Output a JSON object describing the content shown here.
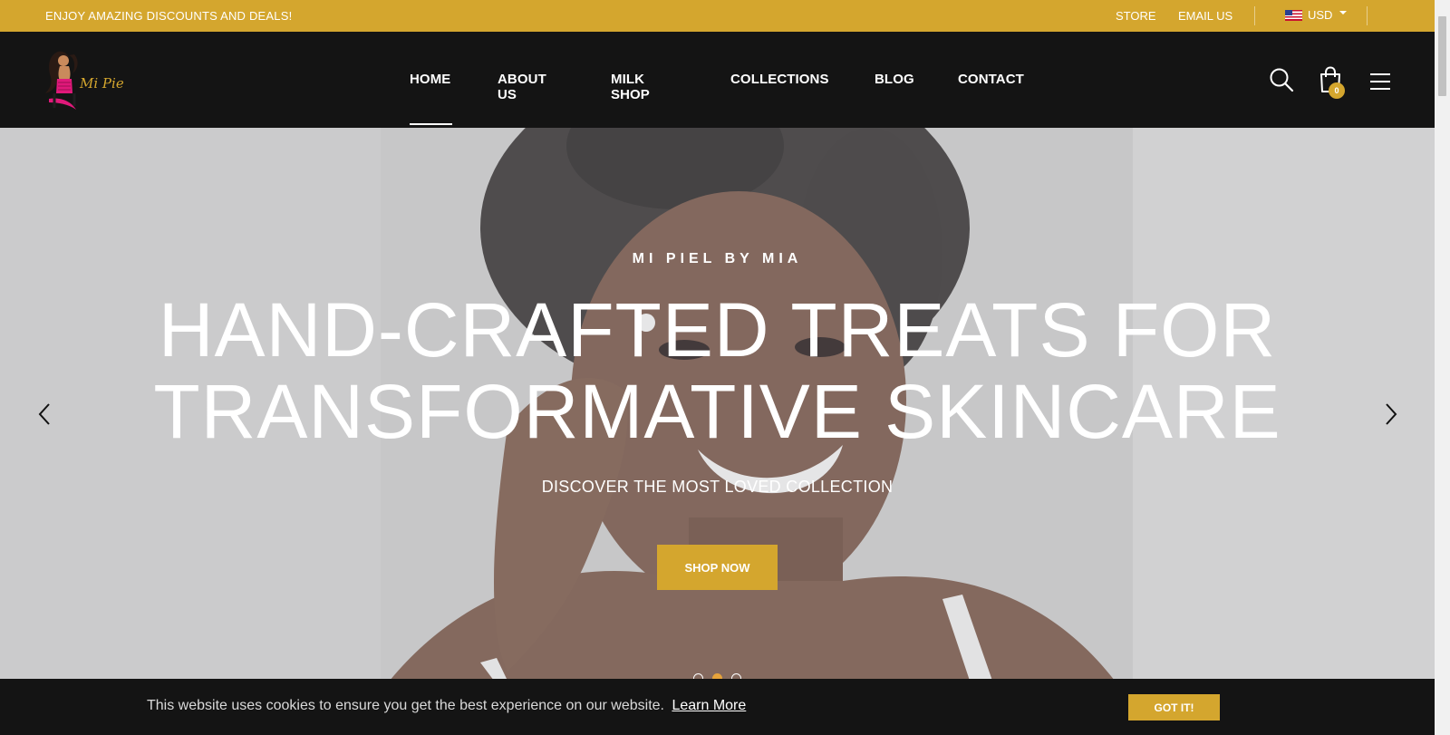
{
  "topbar": {
    "promo": "ENJOY AMAZING DISCOUNTS AND DEALS!",
    "links": [
      "STORE",
      "EMAIL US"
    ],
    "currency": "USD",
    "background": "#d4a62e"
  },
  "header": {
    "logo_text": "Mi Piel",
    "nav": [
      "HOME",
      "ABOUT US",
      "MILK SHOP",
      "COLLECTIONS",
      "BLOG",
      "CONTACT"
    ],
    "active_nav": "HOME",
    "cart_count": "0",
    "icons": [
      "search-icon",
      "cart-icon",
      "menu-icon"
    ],
    "background": "#141414"
  },
  "hero": {
    "eyebrow": "MI PIEL BY MIA",
    "title_line1": "HAND-CRAFTED TREATS FOR",
    "title_line2": "TRANSFORMATIVE SKINCARE",
    "subtitle": "DISCOVER THE MOST LOVED COLLECTION",
    "cta": "SHOP NOW",
    "slides": 3,
    "active_slide": 2,
    "accent": "#d4a62e"
  },
  "cookie": {
    "text": "This website uses cookies to ensure you get the best experience on our website.",
    "link": "Learn More",
    "button": "GOT IT!"
  }
}
